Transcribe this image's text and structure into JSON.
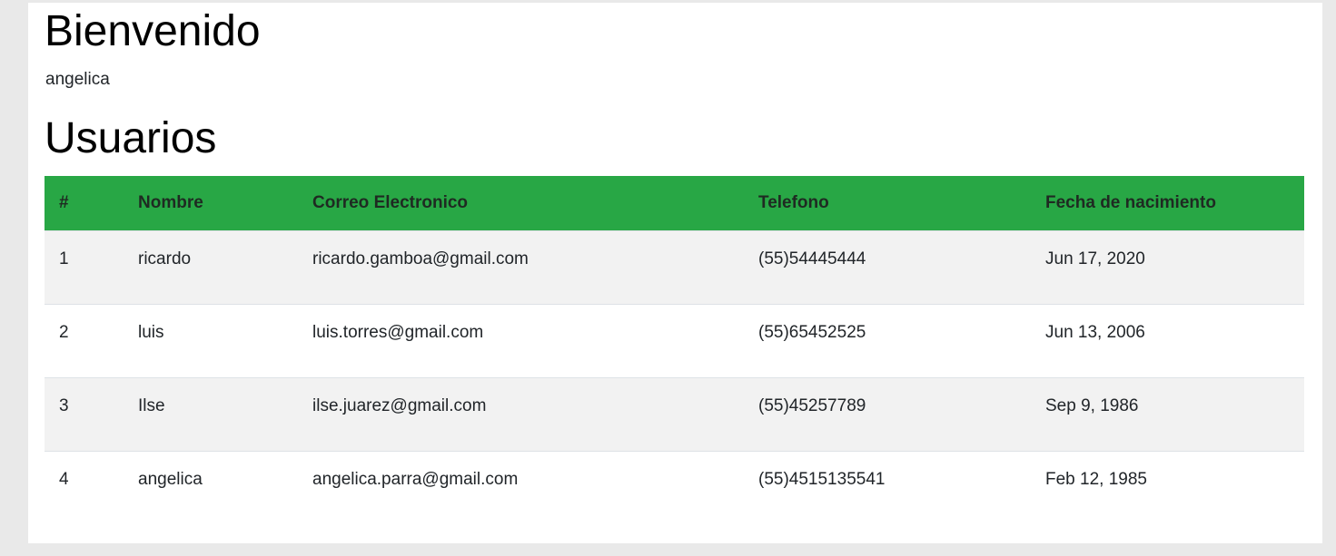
{
  "welcome": {
    "title": "Bienvenido",
    "username": "angelica"
  },
  "users": {
    "title": "Usuarios",
    "columns": [
      "#",
      "Nombre",
      "Correo Electronico",
      "Telefono",
      "Fecha de nacimiento"
    ],
    "rows": [
      {
        "num": "1",
        "name": "ricardo",
        "email": "ricardo.gamboa@gmail.com",
        "phone": "(55)54445444",
        "birthdate": "Jun 17, 2020"
      },
      {
        "num": "2",
        "name": "luis",
        "email": "luis.torres@gmail.com",
        "phone": "(55)65452525",
        "birthdate": "Jun 13, 2006"
      },
      {
        "num": "3",
        "name": "Ilse",
        "email": "ilse.juarez@gmail.com",
        "phone": "(55)45257789",
        "birthdate": "Sep 9, 1986"
      },
      {
        "num": "4",
        "name": "angelica",
        "email": "angelica.parra@gmail.com",
        "phone": "(55)4515135541",
        "birthdate": "Feb 12, 1985"
      }
    ]
  },
  "colors": {
    "header_green": "#28a745",
    "stripe": "#f2f2f2",
    "page_background": "#e9e9e9"
  }
}
